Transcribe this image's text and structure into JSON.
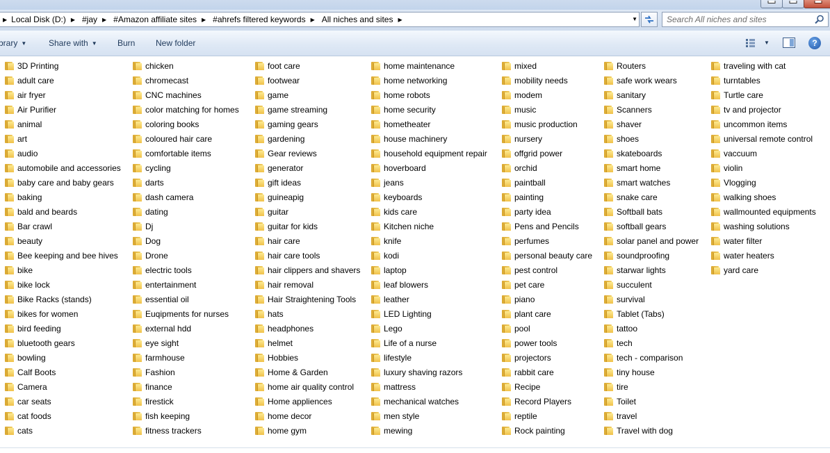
{
  "address_bar": {
    "crumbs": [
      "Local Disk (D:)",
      "#jay",
      "#Amazon affiliate sites",
      "#ahrefs filtered keywords",
      "All niches and sites"
    ]
  },
  "search": {
    "placeholder": "Search All niches and sites"
  },
  "toolbar": {
    "library_label": "brary",
    "share_label": "Share with",
    "burn_label": "Burn",
    "new_folder_label": "New folder",
    "help_label": "?"
  },
  "columns": [
    [
      "3D Printing",
      "adult care",
      "air fryer",
      "Air Purifier",
      "animal",
      "art",
      "audio",
      "automobile and accessories",
      "baby care and baby gears",
      "baking",
      "bald and beards",
      "Bar crawl",
      "beauty",
      "Bee keeping and bee hives",
      "bike",
      "bike lock",
      "Bike Racks (stands)",
      "bikes for women",
      "bird feeding",
      "bluetooth gears",
      "bowling",
      "Calf Boots",
      "Camera",
      "car seats",
      "cat foods",
      "cats"
    ],
    [
      "chicken",
      "chromecast",
      "CNC machines",
      "color matching for homes",
      "coloring books",
      "coloured hair care",
      "comfortable items",
      "cycling",
      "darts",
      "dash camera",
      "dating",
      "Dj",
      "Dog",
      "Drone",
      "electric tools",
      "entertainment",
      "essential oil",
      "Euqipments for nurses",
      "external hdd",
      "eye sight",
      "farmhouse",
      "Fashion",
      "finance",
      "firestick",
      "fish keeping",
      "fitness trackers"
    ],
    [
      "foot care",
      "footwear",
      "game",
      "game streaming",
      "gaming gears",
      "gardening",
      "Gear reviews",
      "generator",
      "gift ideas",
      "guineapig",
      "guitar",
      "guitar for kids",
      "hair care",
      "hair care tools",
      "hair clippers and shavers",
      "hair removal",
      "Hair Straightening Tools",
      "hats",
      "headphones",
      "helmet",
      "Hobbies",
      "Home & Garden",
      "home air quality control",
      "Home appliences",
      "home decor",
      "home gym"
    ],
    [
      "home maintenance",
      "home networking",
      "home robots",
      "home security",
      "hometheater",
      "house machinery",
      "household equipment repair",
      "hoverboard",
      "jeans",
      "keyboards",
      "kids care",
      "Kitchen niche",
      "knife",
      "kodi",
      "laptop",
      "leaf blowers",
      "leather",
      "LED Lighting",
      "Lego",
      "Life of a nurse",
      "lifestyle",
      "luxury shaving razors",
      "mattress",
      "mechanical watches",
      "men style",
      "mewing"
    ],
    [
      "mixed",
      "mobility needs",
      "modem",
      "music",
      "music production",
      "nursery",
      "offgrid power",
      "orchid",
      "paintball",
      "painting",
      "party idea",
      "Pens and Pencils",
      "perfumes",
      "personal beauty care",
      "pest control",
      "pet care",
      "piano",
      "plant care",
      "pool",
      "power tools",
      "projectors",
      "rabbit care",
      "Recipe",
      "Record Players",
      "reptile",
      "Rock painting"
    ],
    [
      "Routers",
      "safe work wears",
      "sanitary",
      "Scanners",
      "shaver",
      "shoes",
      "skateboards",
      "smart home",
      "smart watches",
      "snake care",
      "Softball bats",
      "softball gears",
      "solar panel and power",
      "soundproofing",
      "starwar lights",
      "succulent",
      "survival",
      "Tablet (Tabs)",
      "tattoo",
      "tech",
      "tech - comparison",
      "tiny house",
      "tire",
      "Toilet",
      "travel",
      "Travel with dog"
    ],
    [
      "traveling with cat",
      "turntables",
      "Turtle care",
      "tv and projector",
      "uncommon items",
      "universal remote control",
      "vaccuum",
      "violin",
      "Vlogging",
      "walking shoes",
      "wallmounted equipments",
      "washing solutions",
      "water filter",
      "water heaters",
      "yard care"
    ]
  ]
}
